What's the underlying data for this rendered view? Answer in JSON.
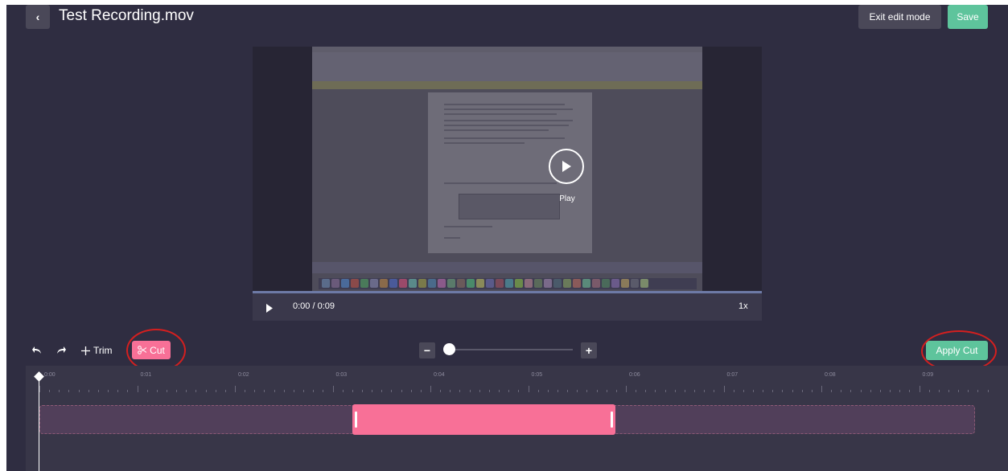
{
  "header": {
    "back_icon": "chevron-left-icon",
    "title": "Test Recording.mov",
    "exit_edit_label": "Exit edit mode",
    "save_label": "Save"
  },
  "video": {
    "overlay_play_label": "Play",
    "time": "0:00 / 0:09",
    "speed": "1x"
  },
  "toolbar": {
    "undo_icon": "undo-icon",
    "redo_icon": "redo-icon",
    "trim_label": "Trim",
    "cut_label": "Cut",
    "apply_label": "Apply Cut",
    "zoom_level": 0.0
  },
  "timeline": {
    "tick_labels": [
      "0:00",
      "0:01",
      "0:02",
      "0:03",
      "0:04",
      "0:05",
      "0:06",
      "0:07",
      "0:08",
      "0:09"
    ],
    "cut_selection": {
      "start_sec": 3.2,
      "end_sec": 5.9
    },
    "playhead_sec": 0
  },
  "colors": {
    "background": "#2f2d41",
    "accent_green": "#5ec49c",
    "accent_pink": "#f87097",
    "annotation_red": "#d41f1f"
  }
}
